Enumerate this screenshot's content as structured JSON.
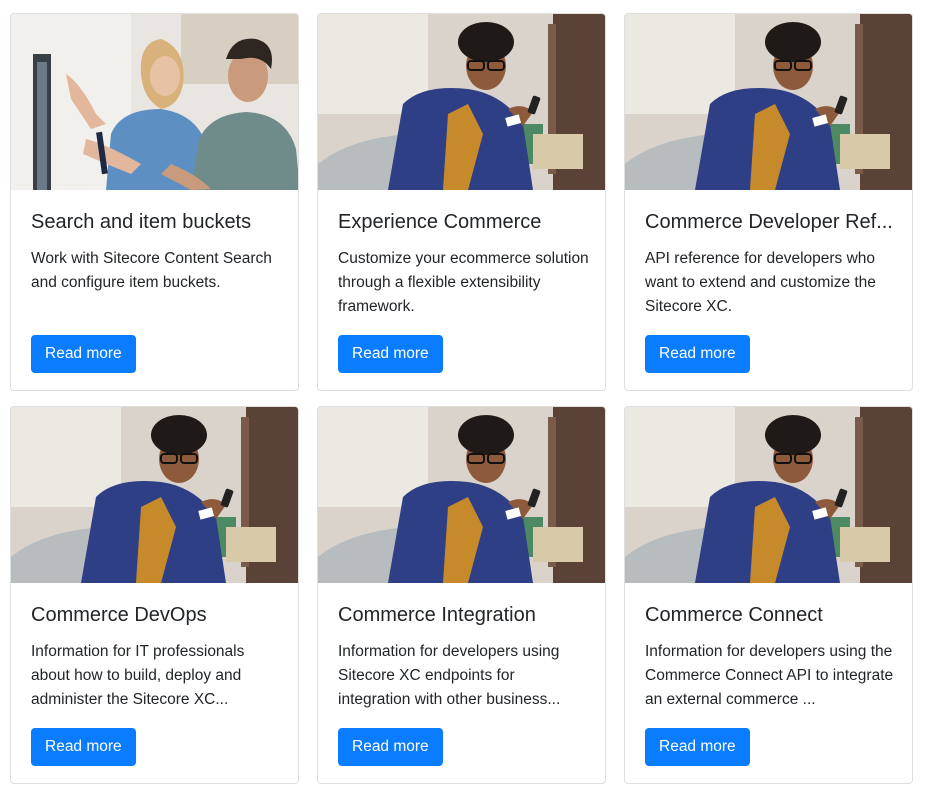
{
  "cards": [
    {
      "image": "office-meeting-photo",
      "title": "Search and item buckets",
      "description": "Work with Sitecore Content Search and configure item buckets.",
      "button": "Read more"
    },
    {
      "image": "shopping-on-phone-photo",
      "title": "Experience Commerce",
      "description": "Customize your ecommerce solution through a flexible extensibility framework.",
      "button": "Read more"
    },
    {
      "image": "shopping-on-phone-photo",
      "title": "Commerce Developer Ref...",
      "description": "API reference for developers who want to extend and customize the Sitecore XC.",
      "button": "Read more"
    },
    {
      "image": "shopping-on-phone-photo",
      "title": "Commerce DevOps",
      "description": "Information for IT professionals about how to build, deploy and administer the Sitecore XC...",
      "button": "Read more"
    },
    {
      "image": "shopping-on-phone-photo",
      "title": "Commerce Integration",
      "description": "Information for developers using Sitecore XC endpoints for integration with other business...",
      "button": "Read more"
    },
    {
      "image": "shopping-on-phone-photo",
      "title": "Commerce Connect",
      "description": "Information for developers using the Commerce Connect API to integrate an external commerce ...",
      "button": "Read more"
    }
  ]
}
